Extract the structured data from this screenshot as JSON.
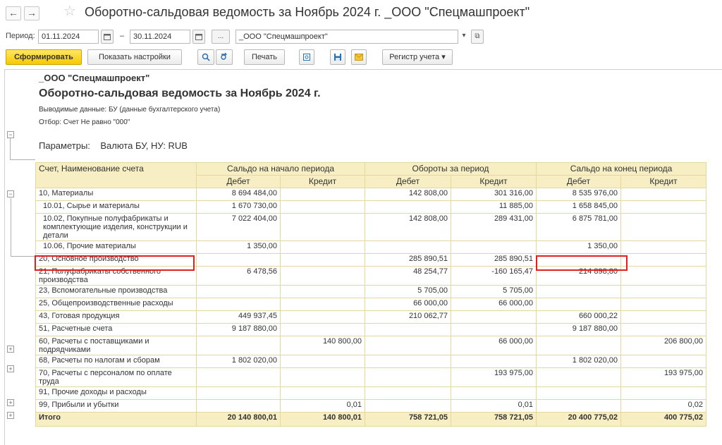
{
  "window": {
    "back": "←",
    "forward": "→",
    "star": "☆",
    "title": "Оборотно-сальдовая ведомость за Ноябрь 2024 г. _ООО \"Спецмашпроект\""
  },
  "period": {
    "label": "Период:",
    "from": "01.11.2024",
    "dash": "–",
    "to": "30.11.2024",
    "dots": "...",
    "org": "_ООО \"Спецмашпроект\"",
    "dropdown": "▾",
    "open": "⧉"
  },
  "toolbar": {
    "generate": "Сформировать",
    "settings": "Показать настройки",
    "print": "Печать",
    "register": "Регистр учета ▾"
  },
  "report": {
    "org": "_ООО \"Спецмашпроект\"",
    "title": "Оборотно-сальдовая ведомость за Ноябрь 2024 г.",
    "output": "Выводимые данные: БУ (данные бухгалтерского учета)",
    "filter": "Отбор: Счет Не равно \"000\"",
    "params": "Параметры:    Валюта БУ, НУ: RUB"
  },
  "table": {
    "head": {
      "account": "Счет, Наименование счета",
      "opening": "Сальдо на начало периода",
      "turnover": "Обороты за период",
      "closing": "Сальдо на конец периода",
      "debit": "Дебет",
      "credit": "Кредит"
    },
    "rows": [
      {
        "name": "10, Материалы",
        "od": "8 694 484,00",
        "oc": "",
        "td": "142 808,00",
        "tc": "301 316,00",
        "cd": "8 535 976,00",
        "cc": ""
      },
      {
        "name": "10.01, Сырье и материалы",
        "od": "1 670 730,00",
        "oc": "",
        "td": "",
        "tc": "11 885,00",
        "cd": "1 658 845,00",
        "cc": ""
      },
      {
        "name": "10.02, Покупные полуфабрикаты и комплектующие изделия, конструкции и детали",
        "od": "7 022 404,00",
        "oc": "",
        "td": "142 808,00",
        "tc": "289 431,00",
        "cd": "6 875 781,00",
        "cc": ""
      },
      {
        "name": "10.06, Прочие материалы",
        "od": "1 350,00",
        "oc": "",
        "td": "",
        "tc": "",
        "cd": "1 350,00",
        "cc": ""
      },
      {
        "name": "20, Основное производство",
        "od": "",
        "oc": "",
        "td": "285 890,51",
        "tc": "285 890,51",
        "cd": "",
        "cc": ""
      },
      {
        "name": "21, Полуфабрикаты собственного производства",
        "od": "6 478,56",
        "oc": "",
        "td": "48 254,77",
        "tc": "-160 165,47",
        "cd": "214 898,80",
        "cc": ""
      },
      {
        "name": "23, Вспомогательные производства",
        "od": "",
        "oc": "",
        "td": "5 705,00",
        "tc": "5 705,00",
        "cd": "",
        "cc": ""
      },
      {
        "name": "25, Общепроизводственные расходы",
        "od": "",
        "oc": "",
        "td": "66 000,00",
        "tc": "66 000,00",
        "cd": "",
        "cc": ""
      },
      {
        "name": "43, Готовая продукция",
        "od": "449 937,45",
        "oc": "",
        "td": "210 062,77",
        "tc": "",
        "cd": "660 000,22",
        "cc": ""
      },
      {
        "name": "51, Расчетные счета",
        "od": "9 187 880,00",
        "oc": "",
        "td": "",
        "tc": "",
        "cd": "9 187 880,00",
        "cc": ""
      },
      {
        "name": "60, Расчеты с поставщиками и подрядчиками",
        "od": "",
        "oc": "140 800,00",
        "td": "",
        "tc": "66 000,00",
        "cd": "",
        "cc": "206 800,00"
      },
      {
        "name": "68, Расчеты по налогам и сборам",
        "od": "1 802 020,00",
        "oc": "",
        "td": "",
        "tc": "",
        "cd": "1 802 020,00",
        "cc": ""
      },
      {
        "name": "70, Расчеты с персоналом по оплате труда",
        "od": "",
        "oc": "",
        "td": "",
        "tc": "193 975,00",
        "cd": "",
        "cc": "193 975,00"
      },
      {
        "name": "91, Прочие доходы и расходы",
        "od": "",
        "oc": "",
        "td": "",
        "tc": "",
        "cd": "",
        "cc": ""
      },
      {
        "name": "99, Прибыли и убытки",
        "od": "",
        "oc": "0,01",
        "td": "",
        "tc": "0,01",
        "cd": "",
        "cc": "0,02"
      }
    ],
    "total": {
      "name": "Итого",
      "od": "20 140 800,01",
      "oc": "140 800,01",
      "td": "758 721,05",
      "tc": "758 721,05",
      "cd": "20 400 775,02",
      "cc": "400 775,02"
    }
  },
  "gutter": {
    "minus": "−",
    "plus": "+"
  },
  "colors": {
    "header_bg": "#f7eec3",
    "border": "#e6d79c",
    "negative": "#ff2020",
    "highlight": "#e02020",
    "primary_btn": "#f5c900"
  }
}
